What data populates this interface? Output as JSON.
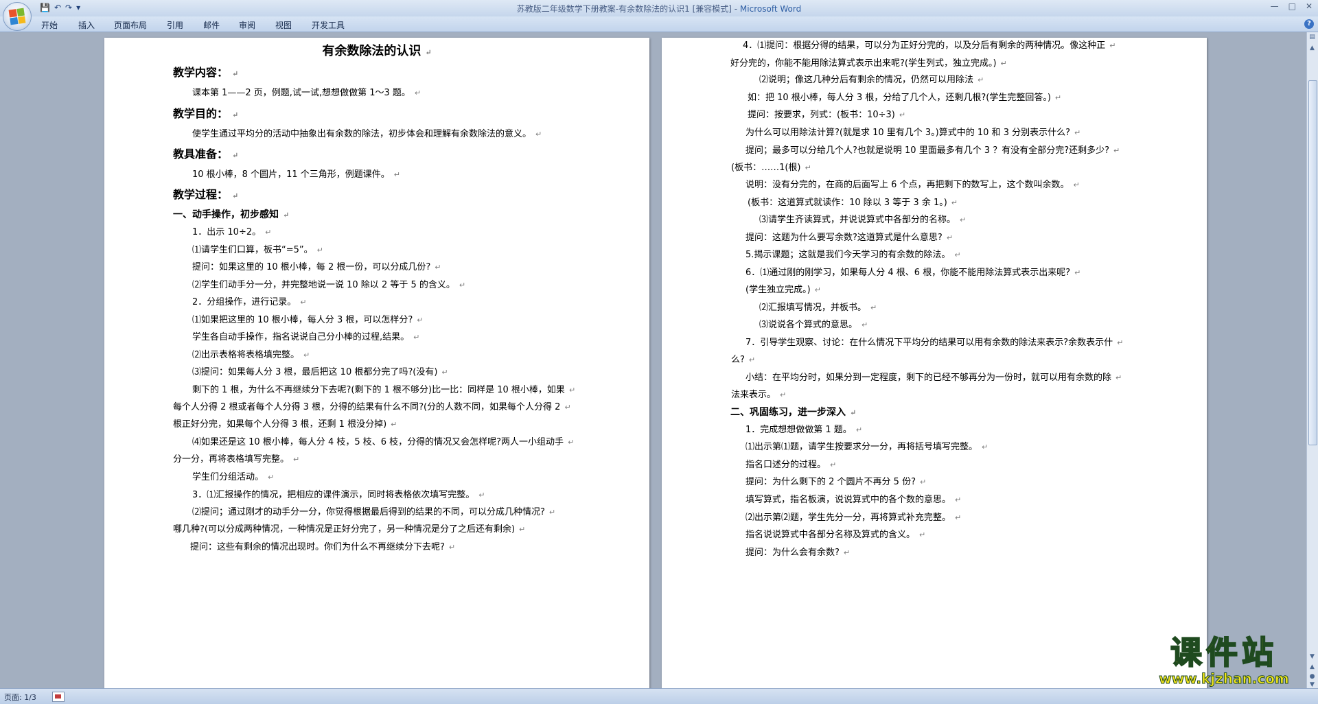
{
  "window": {
    "title": "苏教版二年级数学下册教案-有余数除法的认识1 [兼容模式]",
    "app_name": "Microsoft Word",
    "separator": " - "
  },
  "ribbon_tabs": [
    "开始",
    "插入",
    "页面布局",
    "引用",
    "邮件",
    "审阅",
    "视图",
    "开发工具"
  ],
  "status": {
    "page_info": "页面: 1/3"
  },
  "page1": {
    "lines": [
      {
        "text": "有余数除法的认识",
        "style": "h-title"
      },
      {
        "text": "教学内容：",
        "style": "h-sec"
      },
      {
        "text": "课本第 1——2 页，例题,试一试,想想做做第 1～3 题。",
        "style": ""
      },
      {
        "text": "教学目的：",
        "style": "h-sec"
      },
      {
        "text": "使学生通过平均分的活动中抽象出有余数的除法，初步体会和理解有余数除法的意义。",
        "style": ""
      },
      {
        "text": "教具准备：",
        "style": "h-sec"
      },
      {
        "text": "10 根小棒，8 个圆片，11 个三角形，例题课件。",
        "style": ""
      },
      {
        "text": "教学过程：",
        "style": "h-sec"
      },
      {
        "text": "一、动手操作，初步感知",
        "style": "h-sub"
      },
      {
        "text": "1．出示 10÷2。",
        "style": ""
      },
      {
        "text": "⑴请学生们口算，板书“=5”。",
        "style": ""
      },
      {
        "text": "提问：如果这里的 10 根小棒，每 2 根一份，可以分成几份?",
        "style": ""
      },
      {
        "text": "⑵学生们动手分一分，并完整地说一说 10 除以 2 等于 5 的含义。",
        "style": ""
      },
      {
        "text": "2．分组操作，进行记录。",
        "style": ""
      },
      {
        "text": "⑴如果把这里的 10 根小棒，每人分 3 根，可以怎样分?",
        "style": ""
      },
      {
        "text": "学生各自动手操作，指名说说自己分小棒的过程,结果。",
        "style": ""
      },
      {
        "text": "⑵出示表格将表格填完整。",
        "style": ""
      },
      {
        "text": "⑶提问：如果每人分 3 根，最后把这 10 根都分完了吗?(没有)",
        "style": ""
      },
      {
        "text": "剩下的 1 根，为什么不再继续分下去呢?(剩下的 1 根不够分)比一比：同样是 10 根小棒，如果",
        "style": ""
      },
      {
        "text": "每个人分得 2 根或者每个人分得 3 根，分得的结果有什么不同?(分的人数不同，如果每个人分得 2",
        "style": ""
      },
      {
        "text": "根正好分完，如果每个人分得 3 根，还剩 1 根没分掉)",
        "style": ""
      },
      {
        "text": "⑷如果还是这 10 根小棒，每人分 4 枝，5 枝、6 枝，分得的情况又会怎样呢?两人一小组动手",
        "style": ""
      },
      {
        "text": "分一分，再将表格填写完整。",
        "style": ""
      },
      {
        "text": "学生们分组活动。",
        "style": ""
      },
      {
        "text": "3．⑴汇报操作的情况，把相应的课件演示，同时将表格依次填写完整。",
        "style": ""
      },
      {
        "text": "⑵提问；通过刚才的动手分一分，你觉得根据最后得到的结果的不同，可以分成几种情况?",
        "style": ""
      },
      {
        "text": "哪几种?(可以分成两种情况，一种情况是正好分完了，另一种情况是分了之后还有剩余)",
        "style": ""
      },
      {
        "text": "提问：这些有剩余的情况出现时。你们为什么不再继续分下去呢?",
        "style": ""
      }
    ]
  },
  "page2": {
    "lines": [
      {
        "text": "4．⑴提问：根据分得的结果，可以分为正好分完的，以及分后有剩余的两种情况。像这种正",
        "style": ""
      },
      {
        "text": "好分完的，你能不能用除法算式表示出来呢?(学生列式，独立完成。)",
        "style": ""
      },
      {
        "text": "⑵说明；像这几种分后有剩余的情况，仍然可以用除法",
        "style": ""
      },
      {
        "text": "如：把 10 根小棒，每人分 3 根，分给了几个人，还剩几根?(学生完整回答。)",
        "style": ""
      },
      {
        "text": "提问：按要求，列式：(板书：10÷3)",
        "style": ""
      },
      {
        "text": "为什么可以用除法计算?(就是求 10 里有几个 3。)算式中的 10 和 3 分别表示什么?",
        "style": ""
      },
      {
        "text": "提问；最多可以分给几个人?也就是说明 10 里面最多有几个 3 ？有没有全部分完?还剩多少?",
        "style": ""
      },
      {
        "text": "(板书：……1(根)",
        "style": ""
      },
      {
        "text": "说明：没有分完的，在商的后面写上 6 个点，再把剩下的数写上，这个数叫余数。",
        "style": ""
      },
      {
        "text": "(板书：这道算式就读作：10 除以 3 等于 3 余 1。)",
        "style": ""
      },
      {
        "text": "⑶请学生齐读算式，并说说算式中各部分的名称。",
        "style": ""
      },
      {
        "text": "提问：这题为什么要写余数?这道算式是什么意思?",
        "style": ""
      },
      {
        "text": "5.揭示课题；这就是我们今天学习的有余数的除法。",
        "style": ""
      },
      {
        "text": "6．⑴通过刚的刚学习，如果每人分 4 根、6 根，你能不能用除法算式表示出来呢?",
        "style": ""
      },
      {
        "text": "(学生独立完成。)",
        "style": ""
      },
      {
        "text": "⑵汇报填写情况，并板书。",
        "style": ""
      },
      {
        "text": "⑶说说各个算式的意思。",
        "style": ""
      },
      {
        "text": "7．引导学生观察、讨论：在什么情况下平均分的结果可以用有余数的除法来表示?余数表示什",
        "style": ""
      },
      {
        "text": "么?",
        "style": ""
      },
      {
        "text": "小结：在平均分时，如果分到一定程度，剩下的已经不够再分为一份时，就可以用有余数的除",
        "style": ""
      },
      {
        "text": "法来表示。",
        "style": ""
      },
      {
        "text": "二、巩固练习，进一步深入",
        "style": "h-sub"
      },
      {
        "text": "1．完成想想做做第 1 题。",
        "style": ""
      },
      {
        "text": "⑴出示第⑴题，请学生按要求分一分，再将括号填写完整。",
        "style": ""
      },
      {
        "text": "指名口述分的过程。",
        "style": ""
      },
      {
        "text": "提问：为什么剩下的 2 个圆片不再分 5 份?",
        "style": ""
      },
      {
        "text": "填写算式，指名板演，说说算式中的各个数的意思。",
        "style": ""
      },
      {
        "text": "⑵出示第⑵题，学生先分一分，再将算式补充完整。",
        "style": ""
      },
      {
        "text": "指名说说算式中各部分名称及算式的含义。",
        "style": ""
      },
      {
        "text": "提问：为什么会有余数?",
        "style": ""
      }
    ]
  },
  "watermark": {
    "text": "课件站",
    "url": "www.kjzhan.com"
  }
}
